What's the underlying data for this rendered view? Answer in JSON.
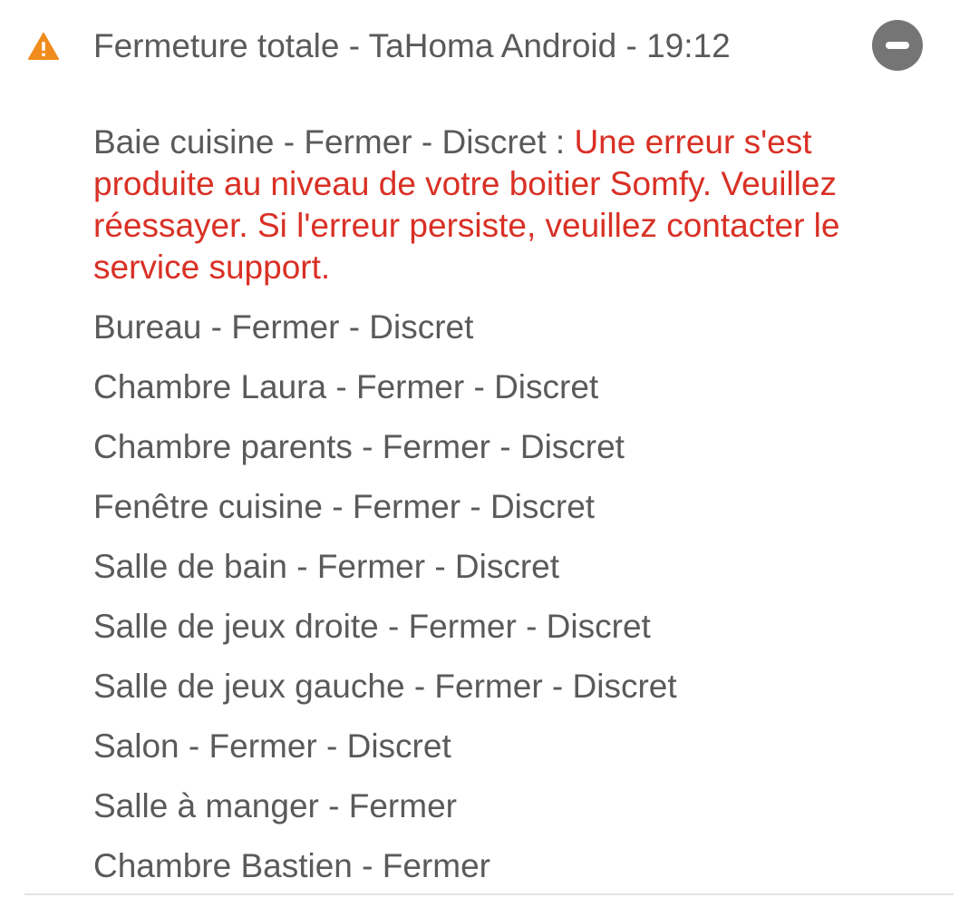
{
  "notification": {
    "title": "Fermeture totale - TaHoma Android - 19:12",
    "icon": "warning-icon",
    "dismiss_icon": "minus-circle-icon",
    "colors": {
      "warning": "#f08c1d",
      "error": "#d93025",
      "text": "#5a5a5a",
      "dismiss_bg": "#757575"
    },
    "error_entry": {
      "prefix": "Baie cuisine - Fermer - Discret : ",
      "message": "Une erreur s'est produite au niveau de votre boitier Somfy. Veuillez réessayer. Si l'erreur persiste, veuillez contacter le service support."
    },
    "items": [
      "Bureau - Fermer - Discret",
      "Chambre Laura - Fermer - Discret",
      "Chambre parents - Fermer - Discret",
      "Fenêtre cuisine - Fermer - Discret",
      "Salle de bain - Fermer - Discret",
      "Salle de jeux droite - Fermer - Discret",
      "Salle de jeux gauche - Fermer - Discret",
      "Salon - Fermer - Discret",
      "Salle à manger - Fermer",
      "Chambre Bastien - Fermer"
    ]
  }
}
